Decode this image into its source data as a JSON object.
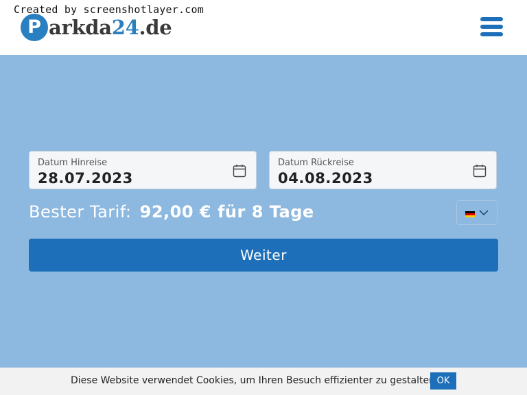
{
  "header": {
    "watermark": "Created by screenshotlayer.com",
    "logo": {
      "badge": "P",
      "text_main": "arkda",
      "text_number": "24",
      "text_tld": ".de"
    },
    "menu_icon": "hamburger-icon"
  },
  "booking": {
    "hinreise": {
      "label": "Datum Hinreise",
      "value": "28.07.2023",
      "icon": "calendar-icon"
    },
    "rueckreise": {
      "label": "Datum Rückreise",
      "value": "04.08.2023",
      "icon": "calendar-icon"
    },
    "tariff": {
      "label": "Bester Tarif:",
      "value": "92,00 € für 8 Tage"
    },
    "language": {
      "icon": "german-flag-icon",
      "dropdown_icon": "chevron-down-icon"
    },
    "submit_label": "Weiter"
  },
  "cookie": {
    "text": "Diese Website verwendet Cookies, um Ihren Besuch effizienter zu gestalten.",
    "ok_label": "OK"
  },
  "colors": {
    "brand_blue": "#1c6fb8",
    "hero_background": "#8db8df"
  }
}
